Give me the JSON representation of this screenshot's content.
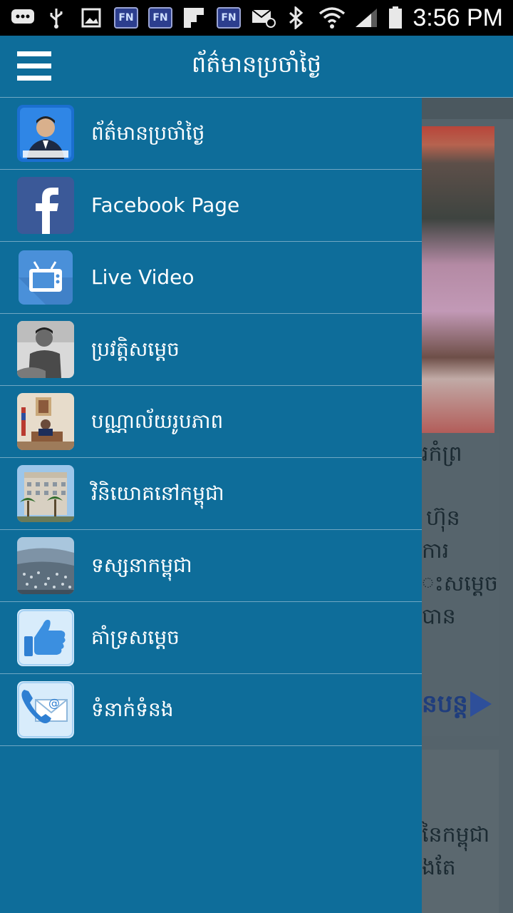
{
  "status_bar": {
    "time": "3:56 PM",
    "icons": [
      "chat-icon",
      "usb-icon",
      "image-icon",
      "fn-icon",
      "fn-icon",
      "flipboard-icon",
      "fn-icon",
      "email-icon",
      "bluetooth-icon",
      "wifi-icon",
      "signal-icon",
      "battery-icon"
    ],
    "fn_label": "FN"
  },
  "app_bar": {
    "title": "ព័ត៌មានប្រចាំថ្ងៃ",
    "menu_icon": "hamburger-menu-icon"
  },
  "drawer": {
    "items": [
      {
        "label": "ព័ត៌មានប្រចាំថ្ងៃ",
        "icon": "news-portrait-icon"
      },
      {
        "label": "Facebook Page",
        "icon": "facebook-icon"
      },
      {
        "label": "Live Video",
        "icon": "tv-icon"
      },
      {
        "label": "ប្រវត្តិសម្តេច",
        "icon": "biography-photo-icon"
      },
      {
        "label": "បណ្ណាល័យរូបភាព",
        "icon": "photo-library-icon"
      },
      {
        "label": "វិនិយោគនៅកម្ពុជា",
        "icon": "investment-building-icon"
      },
      {
        "label": "ទស្សនាកម្ពុជា",
        "icon": "visit-city-icon"
      },
      {
        "label": "គាំទ្រសម្តេច",
        "icon": "thumbs-up-icon"
      },
      {
        "label": "ទំនាក់ទំនង",
        "icon": "contact-phone-mail-icon"
      }
    ]
  },
  "background": {
    "text_lines": [
      "រកំព្រ",
      "ហ៊ុន",
      "ការ",
      "ះសម្តេច",
      "បាន",
      "នៃកម្ពុជា",
      "ងតែ"
    ],
    "more_label": "នបន្ត"
  },
  "colors": {
    "primary": "#0e6d9a",
    "divider": "#6fa7c3",
    "status_bar": "#000000",
    "facebook": "#3b5998"
  }
}
